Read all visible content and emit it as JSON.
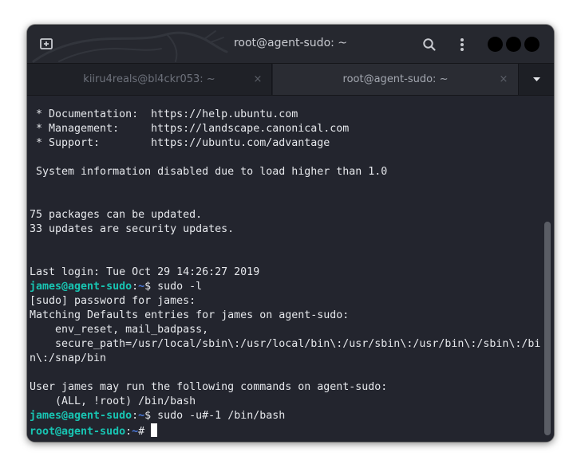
{
  "window": {
    "title": "root@agent-sudo: ~"
  },
  "tabs": [
    {
      "label": "kiiru4reals@bl4ckr053: ~",
      "close": "×",
      "active": false
    },
    {
      "label": "root@agent-sudo: ~",
      "close": "×",
      "active": true
    }
  ],
  "icons": {
    "new_tab": "new-tab-icon",
    "search": "search-icon",
    "menu": "vertical-dots-menu-icon",
    "tabs_dropdown": "caret-down-icon"
  },
  "terminal": {
    "lines": [
      [
        {
          "t": " * Documentation:  https://help.ubuntu.com"
        }
      ],
      [
        {
          "t": " * Management:     https://landscape.canonical.com"
        }
      ],
      [
        {
          "t": " * Support:        https://ubuntu.com/advantage"
        }
      ],
      [
        {
          "t": ""
        }
      ],
      [
        {
          "t": " System information disabled due to load higher than 1.0"
        }
      ],
      [
        {
          "t": ""
        }
      ],
      [
        {
          "t": ""
        }
      ],
      [
        {
          "t": "75 packages can be updated."
        }
      ],
      [
        {
          "t": "33 updates are security updates."
        }
      ],
      [
        {
          "t": ""
        }
      ],
      [
        {
          "t": ""
        }
      ],
      [
        {
          "t": "Last login: Tue Oct 29 14:26:27 2019"
        }
      ],
      [
        {
          "t": "james@agent-sudo",
          "c": "prompt-user"
        },
        {
          "t": ":"
        },
        {
          "t": "~",
          "c": "prompt-path"
        },
        {
          "t": "$ sudo -l"
        }
      ],
      [
        {
          "t": "[sudo] password for james:"
        }
      ],
      [
        {
          "t": "Matching Defaults entries for james on agent-sudo:"
        }
      ],
      [
        {
          "t": "    env_reset, mail_badpass,"
        }
      ],
      [
        {
          "t": "    secure_path=/usr/local/sbin\\:/usr/local/bin\\:/usr/sbin\\:/usr/bin\\:/sbin\\:/bi"
        }
      ],
      [
        {
          "t": "n\\:/snap/bin"
        }
      ],
      [
        {
          "t": ""
        }
      ],
      [
        {
          "t": "User james may run the following commands on agent-sudo:"
        }
      ],
      [
        {
          "t": "    (ALL, !root) /bin/bash"
        }
      ],
      [
        {
          "t": "james@agent-sudo",
          "c": "prompt-user"
        },
        {
          "t": ":"
        },
        {
          "t": "~",
          "c": "prompt-path"
        },
        {
          "t": "$ sudo -u#-1 /bin/bash"
        }
      ],
      [
        {
          "t": "root@agent-sudo",
          "c": "prompt-user"
        },
        {
          "t": ":"
        },
        {
          "t": "~",
          "c": "prompt-path"
        },
        {
          "t": "# "
        },
        {
          "cursor": true
        }
      ]
    ]
  },
  "colors": {
    "terminal_bg": "#23252e",
    "text": "#e6e8ec",
    "prompt_user": "#18c5b3",
    "prompt_path": "#4c7ce0"
  }
}
